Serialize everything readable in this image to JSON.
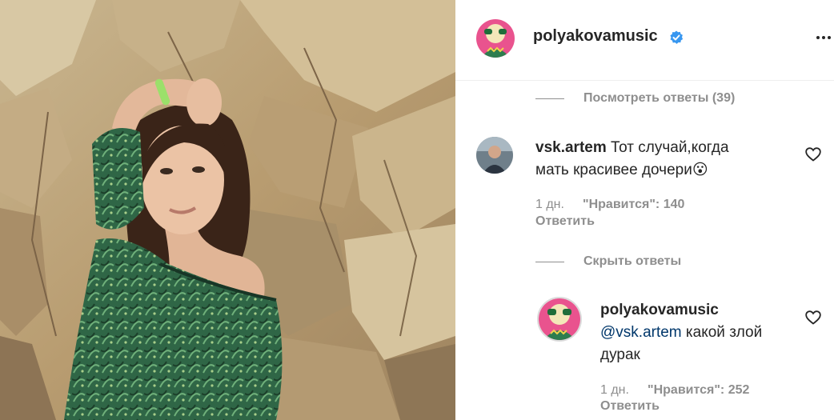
{
  "post_image": {
    "description_icon": "photo-of-woman-against-rock"
  },
  "header": {
    "username": "polyakovamusic",
    "verified": true,
    "more_icon": "more-dots-icon"
  },
  "thread1": {
    "view_replies": "Посмотреть ответы (39)"
  },
  "comment": {
    "username": "vsk.artem",
    "text_line1": "Тот случай,когда",
    "text_line2": "мать красивее дочери",
    "emoji": "😮",
    "time": "1 дн.",
    "likes": "\"Нравится\": 140",
    "reply": "Ответить"
  },
  "thread2": {
    "hide_replies": "Скрыть ответы"
  },
  "reply": {
    "username": "polyakovamusic",
    "mention": "@vsk.artem",
    "text_line1_rest": " какой злой",
    "text_line2": "дурак",
    "time": "1 дн.",
    "likes": "\"Нравится\": 252",
    "reply": "Ответить"
  },
  "colors": {
    "text": "#262626",
    "secondary": "#8e8e8e",
    "verified_blue": "#3897f0",
    "mention": "#00376b",
    "divider": "#efefef"
  }
}
